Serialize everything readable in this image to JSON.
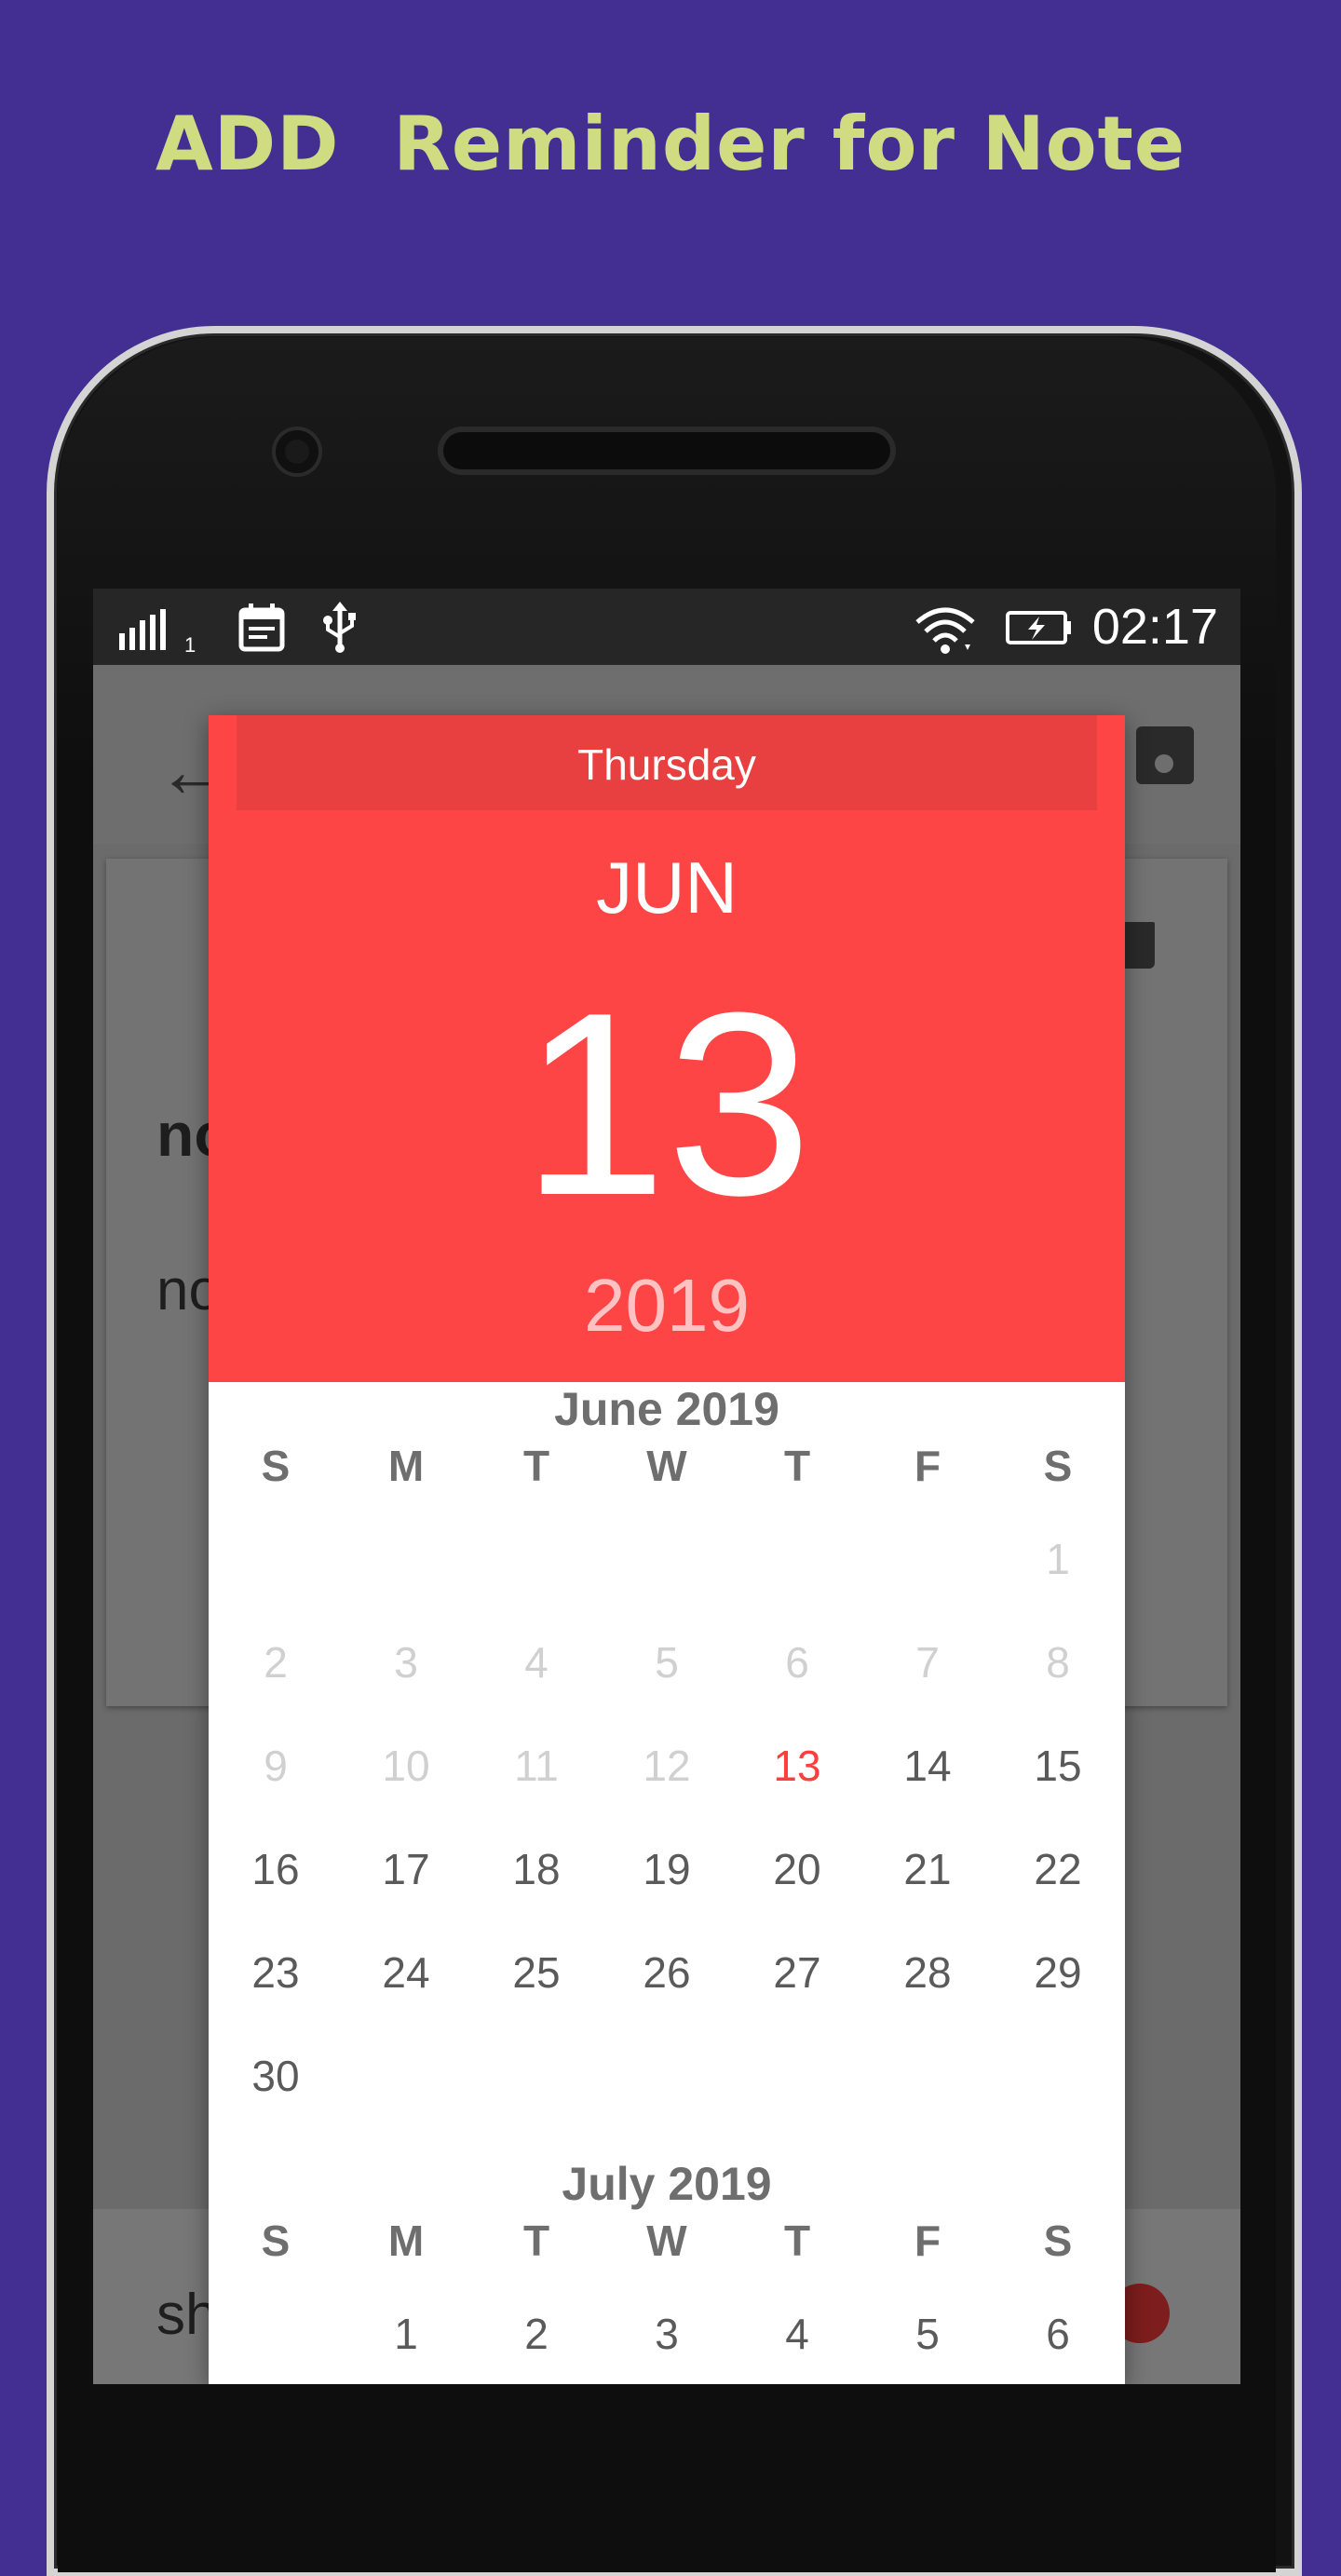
{
  "promo": {
    "title": "ADD  Reminder for Note"
  },
  "statusbar": {
    "time": "02:17",
    "sim_label": "1",
    "icons": [
      "signal-icon",
      "calendar-icon",
      "usb-icon",
      "wifi-icon",
      "battery-charging-icon"
    ]
  },
  "background_app": {
    "title_fragment": "no",
    "body_fragment": "no",
    "bottom_fragment": "sh",
    "icons": [
      "back-arrow-icon",
      "save-icon",
      "trash-icon"
    ]
  },
  "date_picker": {
    "header": {
      "day_of_week": "Thursday",
      "month": "JUN",
      "day": "13",
      "year": "2019"
    },
    "weekday_labels": [
      "S",
      "M",
      "T",
      "W",
      "T",
      "F",
      "S"
    ],
    "months": [
      {
        "title": "June 2019",
        "weeks": [
          [
            "",
            "",
            "",
            "",
            "",
            "",
            "1"
          ],
          [
            "2",
            "3",
            "4",
            "5",
            "6",
            "7",
            "8"
          ],
          [
            "9",
            "10",
            "11",
            "12",
            "13",
            "14",
            "15"
          ],
          [
            "16",
            "17",
            "18",
            "19",
            "20",
            "21",
            "22"
          ],
          [
            "23",
            "24",
            "25",
            "26",
            "27",
            "28",
            "29"
          ],
          [
            "30",
            "",
            "",
            "",
            "",
            "",
            ""
          ]
        ],
        "disabled_through": 12,
        "selected_day": "13"
      },
      {
        "title": "July 2019",
        "weeks": [
          [
            "",
            "1",
            "2",
            "3",
            "4",
            "5",
            "6"
          ]
        ]
      }
    ]
  },
  "colors": {
    "page_background": "#422f91",
    "promo_text": "#cfdc82",
    "picker_header": "#fe4545",
    "picker_selected_text": "#ff3e3e",
    "picker_selected_circle": "#ffd3d3"
  }
}
